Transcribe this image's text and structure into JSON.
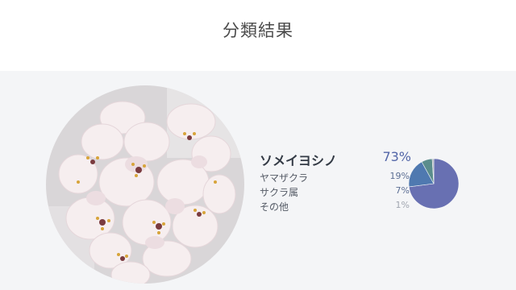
{
  "page": {
    "title": "分類結果"
  },
  "results": [
    {
      "label": "ソメイヨシノ",
      "percent": "73%",
      "value": 73,
      "color": "#6870b2"
    },
    {
      "label": "ヤマザクラ",
      "percent": "19%",
      "value": 19,
      "color": "#4f79b0"
    },
    {
      "label": "サクラ属",
      "percent": "7%",
      "value": 7,
      "color": "#5b8d8c"
    },
    {
      "label": "その他",
      "percent": "1%",
      "value": 1,
      "color": "#a7abb6"
    }
  ],
  "colors": {
    "panel_background": "#f4f5f7",
    "title_text": "#4a4a4a"
  },
  "chart_data": {
    "type": "pie",
    "categories": [
      "ソメイヨシノ",
      "ヤマザクラ",
      "サクラ属",
      "その他"
    ],
    "values": [
      73,
      19,
      7,
      1
    ],
    "title": ""
  }
}
